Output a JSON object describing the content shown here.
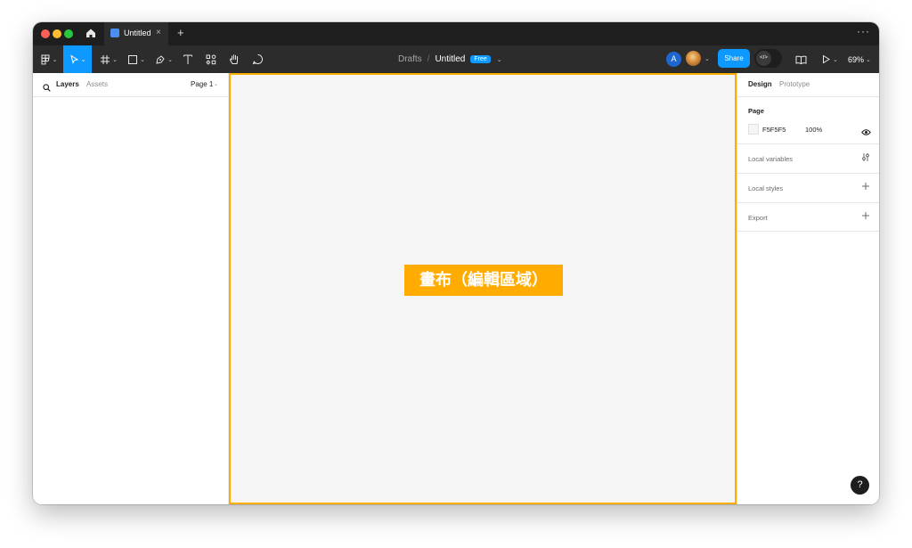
{
  "window": {
    "tab_title": "Untitled",
    "tab_close": "×",
    "tab_add": "+",
    "more_menu": "···"
  },
  "toolbar": {
    "tools": [
      {
        "icon": "main-menu-icon"
      },
      {
        "icon": "move-tool-icon",
        "active": true
      },
      {
        "icon": "frame-tool-icon"
      },
      {
        "icon": "rectangle-tool-icon"
      },
      {
        "icon": "pen-tool-icon"
      },
      {
        "icon": "text-tool-icon"
      },
      {
        "icon": "resources-icon"
      },
      {
        "icon": "hand-tool-icon"
      },
      {
        "icon": "comment-tool-icon"
      }
    ],
    "breadcrumb_drafts": "Drafts",
    "breadcrumb_separator": "/",
    "file_title": "Untitled",
    "plan_badge": "Free",
    "avatar_initial": "A",
    "share_label": "Share",
    "dev_mode_glyph": "</>",
    "zoom_label": "69%",
    "accent_color": "#0d99ff"
  },
  "left_panel": {
    "tab_layers": "Layers",
    "tab_assets": "Assets",
    "page_selector": "Page 1"
  },
  "canvas": {
    "label": "畫布（編輯區域）",
    "background_color": "#F5F5F5",
    "highlight_color": "#ffab00"
  },
  "right_panel": {
    "tab_design": "Design",
    "tab_prototype": "Prototype",
    "page_section_title": "Page",
    "page_color_hex": "F5F5F5",
    "page_opacity": "100%",
    "local_variables_label": "Local variables",
    "local_styles_label": "Local styles",
    "export_label": "Export"
  },
  "help_button": "?"
}
